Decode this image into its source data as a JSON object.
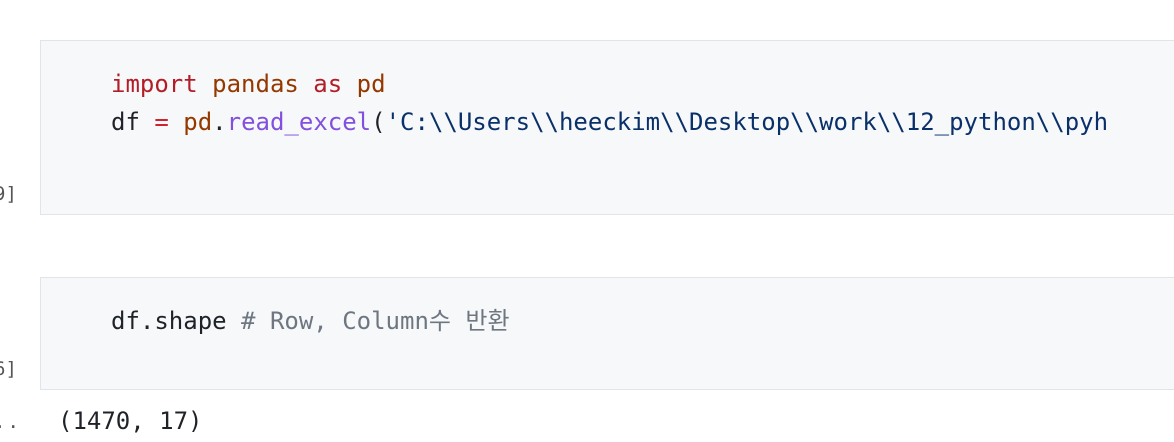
{
  "cells": [
    {
      "exec_count": "9]",
      "lines": [
        {
          "kw_import": "import",
          "mod_pandas": " pandas ",
          "kw_as": "as",
          "mod_pd": " pd"
        },
        {
          "var_df": "df ",
          "op_eq": "=",
          "mod_pd": " pd",
          "dot": ".",
          "fn_read": "read_excel",
          "paren": "(",
          "str_path": "'C:\\\\Users\\\\heeckim\\\\Desktop\\\\work\\\\12_python\\\\pyh"
        }
      ]
    },
    {
      "exec_count": "6]",
      "code": "df.shape ",
      "comment": "# Row, Column수 반환"
    }
  ],
  "output": {
    "prompt": "..",
    "text": "(1470, 17)"
  }
}
